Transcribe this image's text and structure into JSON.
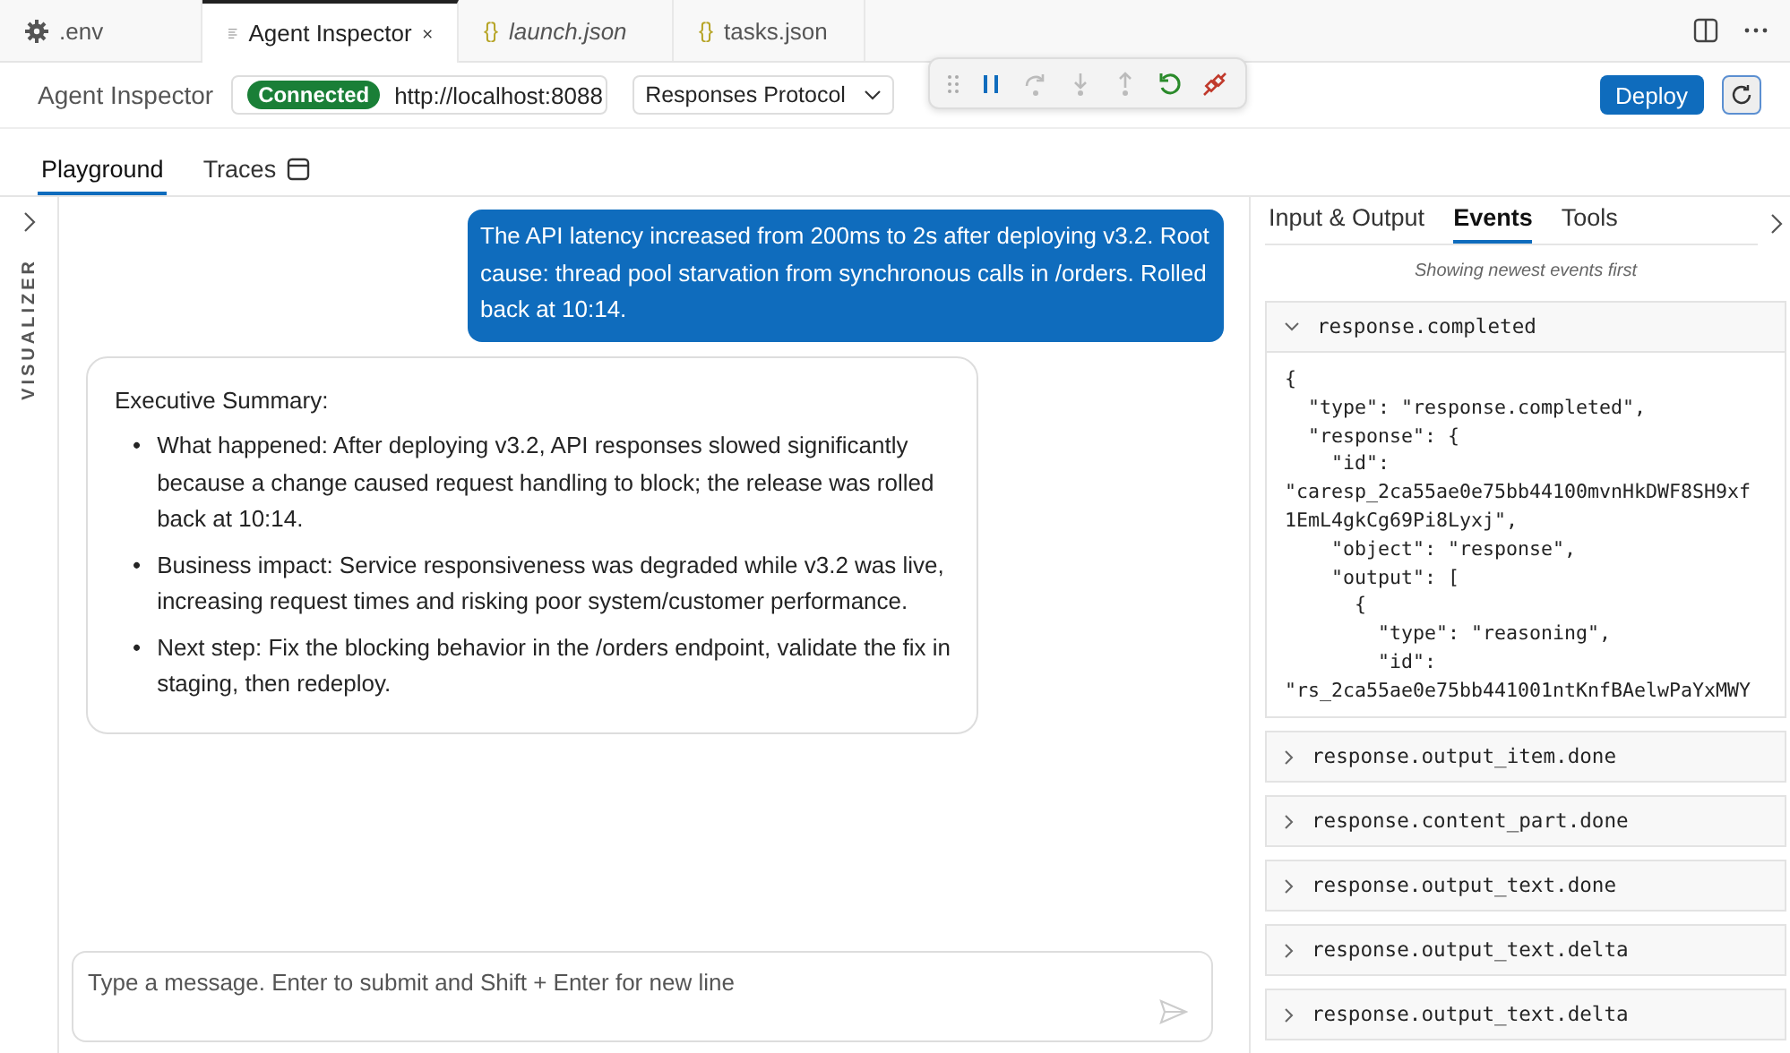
{
  "editor_tabs": [
    {
      "label": ".env",
      "kind": "settings",
      "selected": false,
      "preview": false
    },
    {
      "label": "Agent Inspector",
      "kind": "webview",
      "selected": true,
      "preview": false
    },
    {
      "label": "launch.json",
      "kind": "json",
      "glyph": "{}",
      "selected": false,
      "preview": true
    },
    {
      "label": "tasks.json",
      "kind": "json",
      "glyph": "{}",
      "selected": false,
      "preview": false
    }
  ],
  "header": {
    "title": "Agent Inspector",
    "status": "Connected",
    "url": "http://localhost:8088",
    "protocol": "Responses Protocol",
    "deploy": "Deploy"
  },
  "debug_toolbar": [
    {
      "kind": "pause",
      "disabled": false
    },
    {
      "kind": "step-over",
      "disabled": true
    },
    {
      "kind": "step-into",
      "disabled": true
    },
    {
      "kind": "step-out",
      "disabled": true
    },
    {
      "kind": "restart",
      "disabled": false
    },
    {
      "kind": "disconnect",
      "disabled": false
    }
  ],
  "view_tabs": [
    {
      "label": "Playground",
      "selected": true
    },
    {
      "label": "Traces",
      "selected": false
    }
  ],
  "sidebar": {
    "label": "VISUALIZER"
  },
  "chat": {
    "user_message": "The API latency increased from 200ms to 2s after deploying v3.2. Root cause: thread pool starvation from synchronous calls in /orders. Rolled back at 10:14.",
    "reply": {
      "heading": "Executive Summary:",
      "bullets": [
        {
          "marker": "•",
          "text": "What happened: After deploying v3.2, API responses slowed significantly because a change caused request handling to block; the release was rolled back at 10:14."
        },
        {
          "marker": "•",
          "text": "Business impact: Service responsiveness was degraded while v3.2 was live, increasing request times and risking poor system/customer performance."
        },
        {
          "marker": "•",
          "text": "Next step: Fix the blocking behavior in the /orders endpoint, validate the fix in staging, then redeploy."
        }
      ]
    },
    "input": {
      "placeholder": "Type a message. Enter to submit and Shift + Enter for new line"
    }
  },
  "panel_tabs": [
    {
      "label": "Input & Output",
      "selected": false
    },
    {
      "label": "Events",
      "selected": true
    },
    {
      "label": "Tools",
      "selected": false
    }
  ],
  "events_note": "Showing newest events first",
  "events": [
    {
      "name": "response.completed",
      "expanded": true,
      "body": "{\n  \"type\": \"response.completed\",\n  \"response\": {\n    \"id\":\n\"caresp_2ca55ae0e75bb44100mvnHkDWF8SH9xf\n1EmL4gkCg69Pi8Lyxj\",\n    \"object\": \"response\",\n    \"output\": [\n      {\n        \"type\": \"reasoning\",\n        \"id\":\n\"rs_2ca55ae0e75bb441001ntKnfBAelwPaYxMWY"
    },
    {
      "name": "response.output_item.done",
      "expanded": false
    },
    {
      "name": "response.content_part.done",
      "expanded": false
    },
    {
      "name": "response.output_text.done",
      "expanded": false
    },
    {
      "name": "response.output_text.delta",
      "expanded": false
    },
    {
      "name": "response.output_text.delta",
      "expanded": false
    }
  ]
}
